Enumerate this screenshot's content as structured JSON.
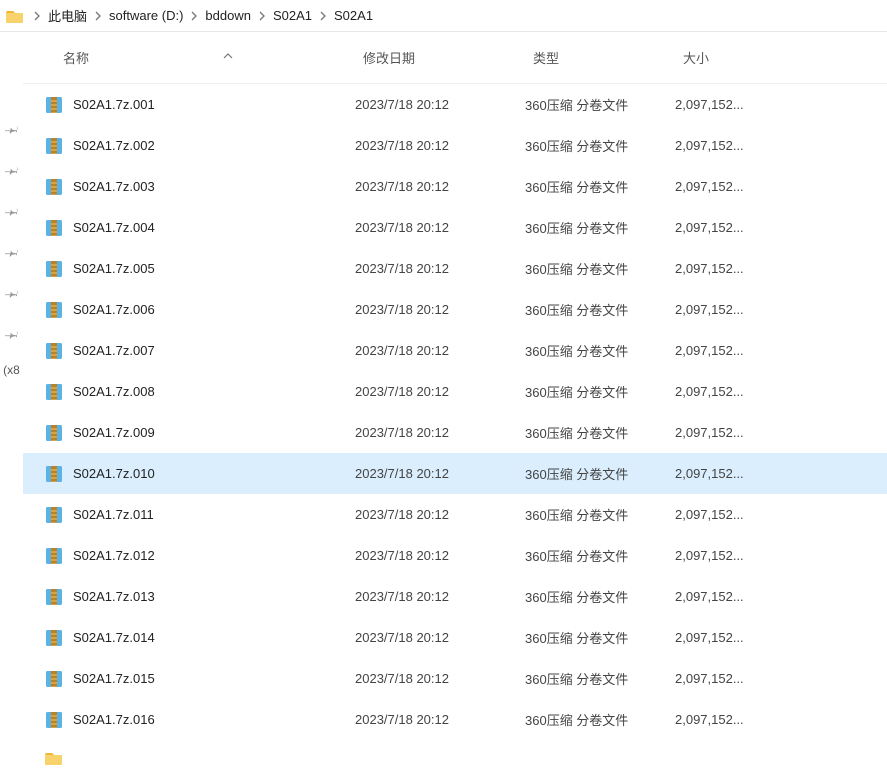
{
  "breadcrumb": [
    "此电脑",
    "software (D:)",
    "bddown",
    "S02A1",
    "S02A1"
  ],
  "columns": {
    "name": "名称",
    "date": "修改日期",
    "type": "类型",
    "size": "大小"
  },
  "sidebar_text": "(x8",
  "files": [
    {
      "name": "S02A1.7z.001",
      "date": "2023/7/18 20:12",
      "type": "360压缩 分卷文件",
      "size": "2,097,152...",
      "pinned": false,
      "selected": false
    },
    {
      "name": "S02A1.7z.002",
      "date": "2023/7/18 20:12",
      "type": "360压缩 分卷文件",
      "size": "2,097,152...",
      "pinned": true,
      "selected": false
    },
    {
      "name": "S02A1.7z.003",
      "date": "2023/7/18 20:12",
      "type": "360压缩 分卷文件",
      "size": "2,097,152...",
      "pinned": true,
      "selected": false
    },
    {
      "name": "S02A1.7z.004",
      "date": "2023/7/18 20:12",
      "type": "360压缩 分卷文件",
      "size": "2,097,152...",
      "pinned": true,
      "selected": false
    },
    {
      "name": "S02A1.7z.005",
      "date": "2023/7/18 20:12",
      "type": "360压缩 分卷文件",
      "size": "2,097,152...",
      "pinned": true,
      "selected": false
    },
    {
      "name": "S02A1.7z.006",
      "date": "2023/7/18 20:12",
      "type": "360压缩 分卷文件",
      "size": "2,097,152...",
      "pinned": true,
      "selected": false
    },
    {
      "name": "S02A1.7z.007",
      "date": "2023/7/18 20:12",
      "type": "360压缩 分卷文件",
      "size": "2,097,152...",
      "pinned": true,
      "selected": false
    },
    {
      "name": "S02A1.7z.008",
      "date": "2023/7/18 20:12",
      "type": "360压缩 分卷文件",
      "size": "2,097,152...",
      "pinned": false,
      "selected": false
    },
    {
      "name": "S02A1.7z.009",
      "date": "2023/7/18 20:12",
      "type": "360压缩 分卷文件",
      "size": "2,097,152...",
      "pinned": false,
      "selected": false
    },
    {
      "name": "S02A1.7z.010",
      "date": "2023/7/18 20:12",
      "type": "360压缩 分卷文件",
      "size": "2,097,152...",
      "pinned": false,
      "selected": true
    },
    {
      "name": "S02A1.7z.011",
      "date": "2023/7/18 20:12",
      "type": "360压缩 分卷文件",
      "size": "2,097,152...",
      "pinned": false,
      "selected": false
    },
    {
      "name": "S02A1.7z.012",
      "date": "2023/7/18 20:12",
      "type": "360压缩 分卷文件",
      "size": "2,097,152...",
      "pinned": false,
      "selected": false
    },
    {
      "name": "S02A1.7z.013",
      "date": "2023/7/18 20:12",
      "type": "360压缩 分卷文件",
      "size": "2,097,152...",
      "pinned": false,
      "selected": false
    },
    {
      "name": "S02A1.7z.014",
      "date": "2023/7/18 20:12",
      "type": "360压缩 分卷文件",
      "size": "2,097,152...",
      "pinned": false,
      "selected": false
    },
    {
      "name": "S02A1.7z.015",
      "date": "2023/7/18 20:12",
      "type": "360压缩 分卷文件",
      "size": "2,097,152...",
      "pinned": false,
      "selected": false
    },
    {
      "name": "S02A1.7z.016",
      "date": "2023/7/18 20:12",
      "type": "360压缩 分卷文件",
      "size": "2,097,152...",
      "pinned": false,
      "selected": false
    }
  ]
}
